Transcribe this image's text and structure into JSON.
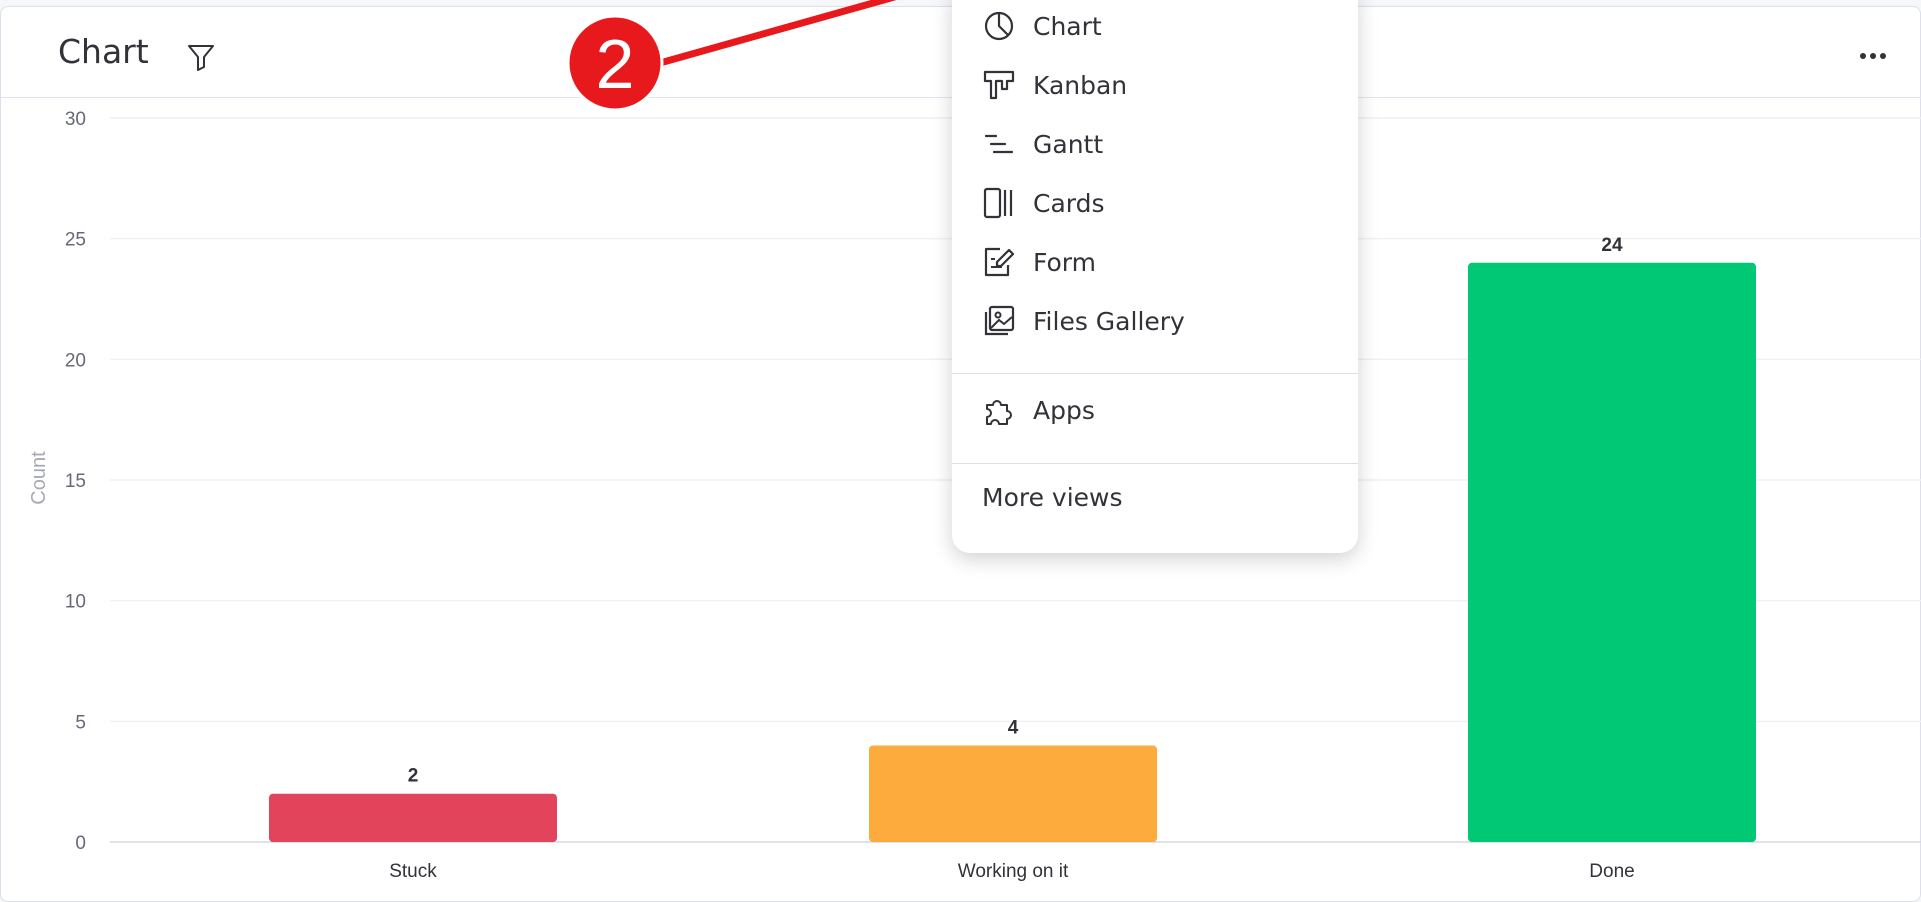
{
  "header": {
    "title": "Chart"
  },
  "icons": {
    "filter": "filter-icon",
    "more": "more-options-icon"
  },
  "menu": {
    "items": [
      {
        "label": "Chart",
        "icon": "pie-chart-icon"
      },
      {
        "label": "Kanban",
        "icon": "kanban-icon"
      },
      {
        "label": "Gantt",
        "icon": "gantt-icon"
      },
      {
        "label": "Cards",
        "icon": "cards-icon"
      },
      {
        "label": "Form",
        "icon": "form-icon"
      },
      {
        "label": "Files Gallery",
        "icon": "files-gallery-icon"
      },
      {
        "label": "Apps",
        "icon": "puzzle-icon"
      }
    ],
    "more_views": "More views"
  },
  "annotation": {
    "step_number": "2",
    "color": "#e8191c"
  },
  "chart_data": {
    "type": "bar",
    "categories": [
      "Stuck",
      "Working on it",
      "Done"
    ],
    "values": [
      2,
      4,
      24
    ],
    "colors": [
      "#e2445c",
      "#fdab3d",
      "#00c875"
    ],
    "ylabel": "Count",
    "ylim": [
      0,
      30
    ],
    "yticks": [
      0,
      5,
      10,
      15,
      20,
      25,
      30
    ],
    "grid": true,
    "data_labels": true
  }
}
